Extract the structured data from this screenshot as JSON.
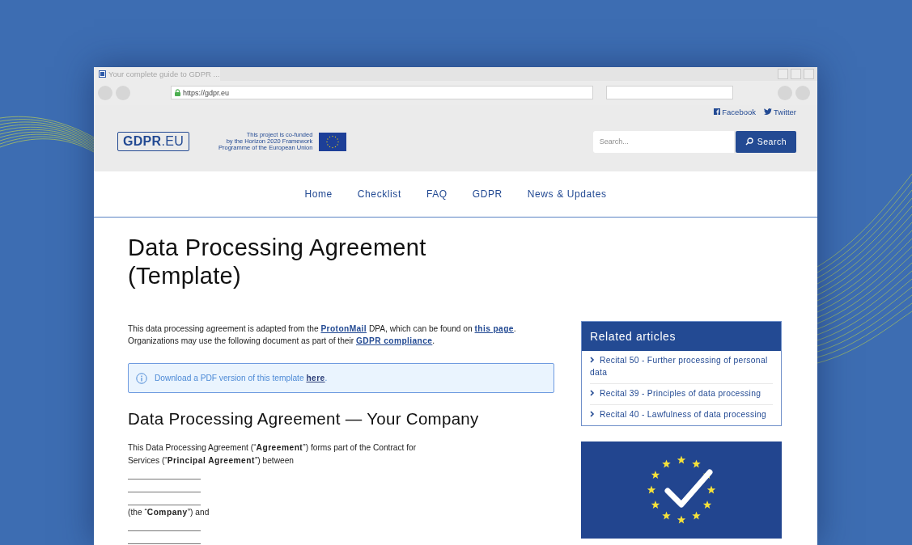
{
  "browser": {
    "tab_title": "Your complete guide to GDPR ...",
    "url": "https://gdpr.eu"
  },
  "social_links": [
    {
      "kind": "facebook",
      "label": "Facebook"
    },
    {
      "kind": "twitter",
      "label": "Twitter"
    }
  ],
  "logo": "**GDPR**.EU",
  "funding_note": [
    "This project is co-funded",
    "by the Horizon 2020 Framework",
    "Programme of the European Union"
  ],
  "search": {
    "placeholder": "Search...",
    "button": "Search"
  },
  "nav": [
    {
      "label": "Home"
    },
    {
      "label": "Checklist"
    },
    {
      "label": "FAQ"
    },
    {
      "label": "GDPR"
    },
    {
      "label": "News & Updates"
    }
  ],
  "title": "Data Processing Agreement (Template)",
  "intro": [
    [
      {
        "kind": "text",
        "text": "This data processing agreement is adapted from the "
      },
      {
        "kind": "link",
        "text": "ProtonMail"
      },
      {
        "kind": "text",
        "text": " DPA, which can be found on "
      },
      {
        "kind": "link",
        "text": "this page"
      },
      {
        "kind": "text",
        "text": "."
      }
    ],
    [
      {
        "kind": "text",
        "text": "Organizations may use the following document as part of their "
      },
      {
        "kind": "link",
        "text": "GDPR compliance"
      },
      {
        "kind": "text",
        "text": "."
      }
    ]
  ],
  "notice": [
    {
      "kind": "text",
      "text": "Download a PDF version of this template "
    },
    {
      "kind": "link",
      "text": "here"
    },
    {
      "kind": "text",
      "text": "."
    }
  ],
  "section_title": "Data Processing Agreement — Your Company",
  "body": [
    {
      "kind": "paragraph",
      "text": "This Data Processing Agreement (“**Agreement**”) forms part of the Contract for Services (“**Principal Agreement**”) between"
    },
    {
      "kind": "blank"
    },
    {
      "kind": "blank"
    },
    {
      "kind": "blank"
    },
    {
      "kind": "paragraph",
      "text": "(the “**Company**”) and"
    },
    {
      "kind": "blank"
    },
    {
      "kind": "blank"
    }
  ],
  "sidebar": {
    "title": "Related articles",
    "items": [
      {
        "label": "Recital 50 - Further processing of personal data"
      },
      {
        "label": "Recital 39 - Principles of data processing"
      },
      {
        "label": "Recital 40 - Lawfulness of data processing"
      }
    ]
  }
}
